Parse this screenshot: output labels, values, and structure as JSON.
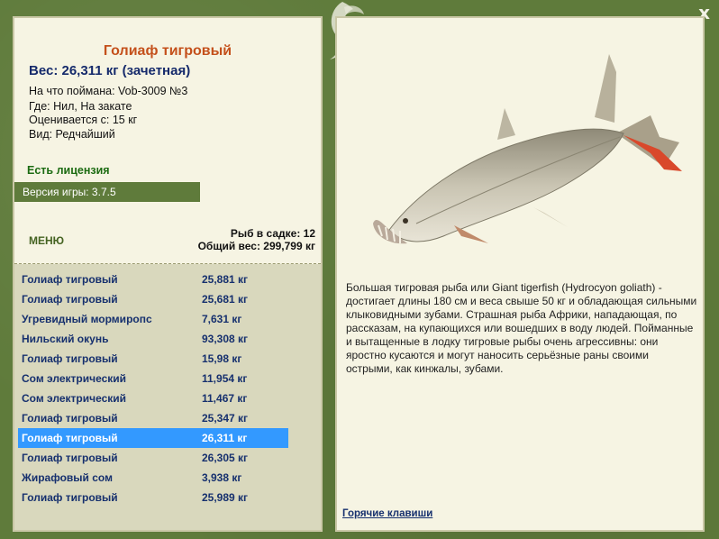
{
  "close_label": "x",
  "fish": {
    "title": "Голиаф тигровый",
    "weight_line": "Вес: 26,311 кг (зачетная)",
    "caught_with": "На что поймана: Vob-3009 №3",
    "where": "Где: Нил, На закате",
    "rated_from": "Оценивается с: 15 кг",
    "species_kind": "Вид: Редчайший"
  },
  "license_label": "Есть лицензия",
  "version_label": "Версия игры: 3.7.5",
  "menu_label": "МЕНЮ",
  "stats": {
    "in_keepnet": "Рыб в садке: 12",
    "total_weight": "Общий вес: 299,799 кг"
  },
  "catch_list": [
    {
      "name": "Голиаф тигровый",
      "weight": "25,881 кг"
    },
    {
      "name": "Голиаф тигровый",
      "weight": "25,681 кг"
    },
    {
      "name": "Угревидный мормиропс",
      "weight": "7,631 кг"
    },
    {
      "name": "Нильский окунь",
      "weight": "93,308 кг"
    },
    {
      "name": "Голиаф тигровый",
      "weight": "15,98 кг"
    },
    {
      "name": "Сом электрический",
      "weight": "11,954 кг"
    },
    {
      "name": "Сом электрический",
      "weight": "11,467 кг"
    },
    {
      "name": "Голиаф тигровый",
      "weight": "25,347 кг"
    },
    {
      "name": "Голиаф тигровый",
      "weight": "26,311 кг"
    },
    {
      "name": "Голиаф тигровый",
      "weight": "26,305 кг"
    },
    {
      "name": "Жирафовый сом",
      "weight": "3,938 кг"
    },
    {
      "name": "Голиаф тигровый",
      "weight": "25,989 кг"
    }
  ],
  "selected_index": 8,
  "description": "Большая тигровая рыба или Giant tigerfish (Hydrocyon goliath) - достигает длины 180 см и веса свыше 50 кг и обладающая сильными клыковидными зубами. Страшная рыба Африки, нападающая, по рассказам, на купающихся или вошедших в воду людей. Пойманные и вытащенные в лодку тигровые рыбы очень агрессивны: они яростно кусаются и могут наносить серьёзные раны своими острыми, как кинжалы, зубами.",
  "hotkeys_label": "Горячие клавиши",
  "icons": {
    "close": "close-icon",
    "decoration": "leaf-ornament-icon",
    "fish": "tigerfish-image"
  },
  "colors": {
    "frame": "#5f7b3b",
    "panel": "#f6f4e3",
    "title": "#c4501b",
    "list_text": "#16306e",
    "selection": "#3399ff",
    "license": "#1c6b12"
  }
}
